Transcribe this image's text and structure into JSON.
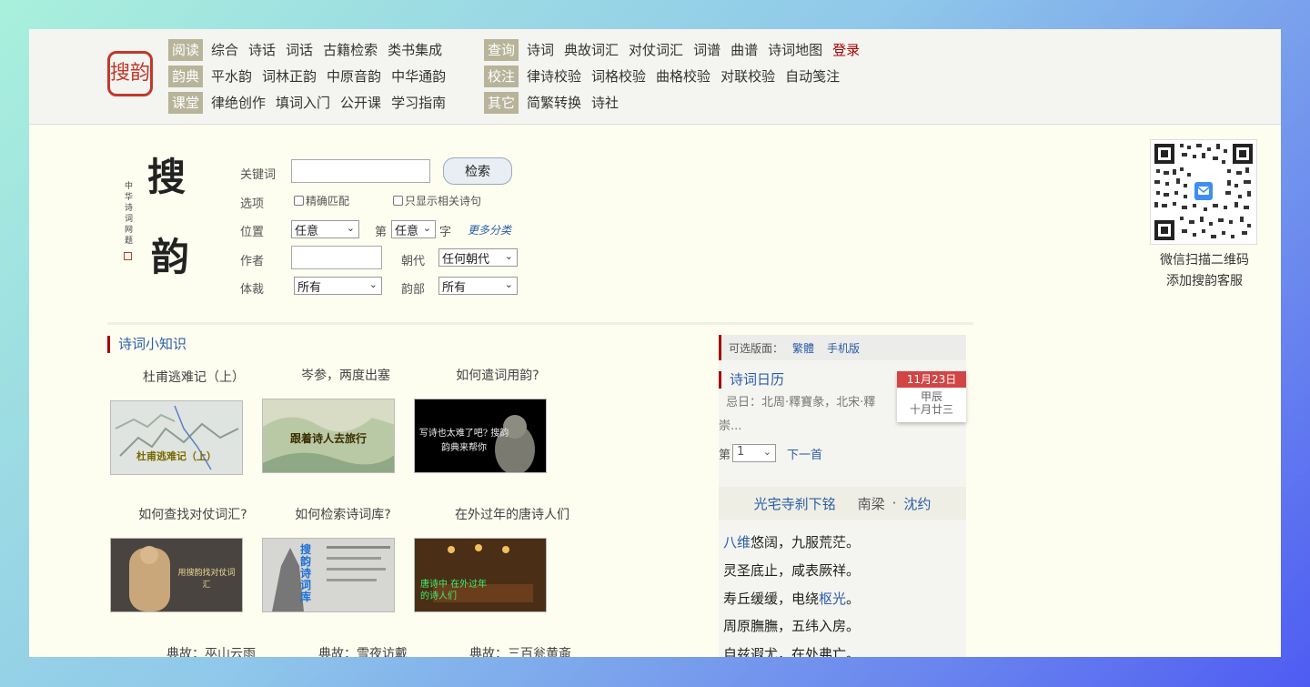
{
  "logo": {
    "text": "搜韵"
  },
  "nav": {
    "left": [
      {
        "cat": "阅读",
        "links": [
          "综合",
          "诗话",
          "词话",
          "古籍检索",
          "类书集成"
        ]
      },
      {
        "cat": "韵典",
        "links": [
          "平水韵",
          "词林正韵",
          "中原音韵",
          "中华通韵"
        ]
      },
      {
        "cat": "课堂",
        "links": [
          "律绝创作",
          "填词入门",
          "公开课",
          "学习指南"
        ]
      }
    ],
    "right": [
      {
        "cat": "查询",
        "links": [
          "诗词",
          "典故词汇",
          "对仗词汇",
          "词谱",
          "曲谱",
          "诗词地图"
        ],
        "login": "登录"
      },
      {
        "cat": "校注",
        "links": [
          "律诗校验",
          "词格校验",
          "曲格校验",
          "对联校验",
          "自动笺注"
        ]
      },
      {
        "cat": "其它",
        "links": [
          "简繁转换",
          "诗社"
        ]
      }
    ]
  },
  "search_logo": {
    "char1": "搜",
    "char2": "韵",
    "vertical": "中华诗词网题"
  },
  "search": {
    "keyword_label": "关键词",
    "keyword_value": "",
    "submit": "检索",
    "options_label": "选项",
    "exact_match": "精确匹配",
    "only_related": "只显示相关诗句",
    "position_label": "位置",
    "position_value": "任意",
    "index_label": "第",
    "index_value": "任意",
    "char_label": "字",
    "more": "更多分类",
    "author_label": "作者",
    "author_value": "",
    "dynasty_label": "朝代",
    "dynasty_value": "任何朝代",
    "genre_label": "体裁",
    "genre_value": "所有",
    "rhyme_label": "韵部",
    "rhyme_value": "所有"
  },
  "qr": {
    "line1": "微信扫描二维码",
    "line2": "添加搜韵客服"
  },
  "knowledge": {
    "title": "诗词小知识",
    "cards": [
      {
        "title": "杜甫逃难记（上）",
        "caption": "杜甫逃难记（上）"
      },
      {
        "title": "岑参，两度出塞",
        "caption": "跟着诗人去旅行"
      },
      {
        "title": "如何遣词用韵?",
        "caption": "写诗也太难了吧? 搜韵韵典来帮你"
      },
      {
        "title": "如何查找对仗词汇?",
        "caption": "用搜韵找对仗词汇"
      },
      {
        "title": "如何检索诗词库?",
        "caption": "搜韵诗词库"
      },
      {
        "title": "在外过年的唐诗人们",
        "caption": "唐诗中 在外过年的诗人们"
      },
      {
        "title": "典故：巫山云雨"
      },
      {
        "title": "典故：雪夜访戴"
      },
      {
        "title": "典故：三百瓮黄齑"
      }
    ]
  },
  "side": {
    "options_label": "可选版面：",
    "opt_trad": "繁體",
    "opt_mobile": "手机版",
    "calendar_title": "诗词日历",
    "date": "11月23日",
    "ganzhi": "甲辰",
    "lunar": "十月廿三",
    "ji_text": "忌日：北周·釋寶彖，北宋·釋崇...",
    "page_prefix": "第",
    "page_value": "1",
    "next": "下一首",
    "poem_title": "光宅寺刹下铭",
    "poem_dynasty": "南梁",
    "poem_author": "沈约",
    "lines": [
      {
        "hl": "八维",
        "rest": "悠阔，九服荒茫。"
      },
      {
        "hl": "",
        "rest": "灵圣底止，咸表厥祥。"
      },
      {
        "hl": "",
        "pre": "寿丘缓缓，电绕",
        "hl2": "枢光",
        "rest": "。"
      },
      {
        "hl": "",
        "rest": "周原膴膴，五纬入房。"
      },
      {
        "hl": "",
        "rest": "自兹遐尤，在处弗亡。"
      }
    ]
  }
}
